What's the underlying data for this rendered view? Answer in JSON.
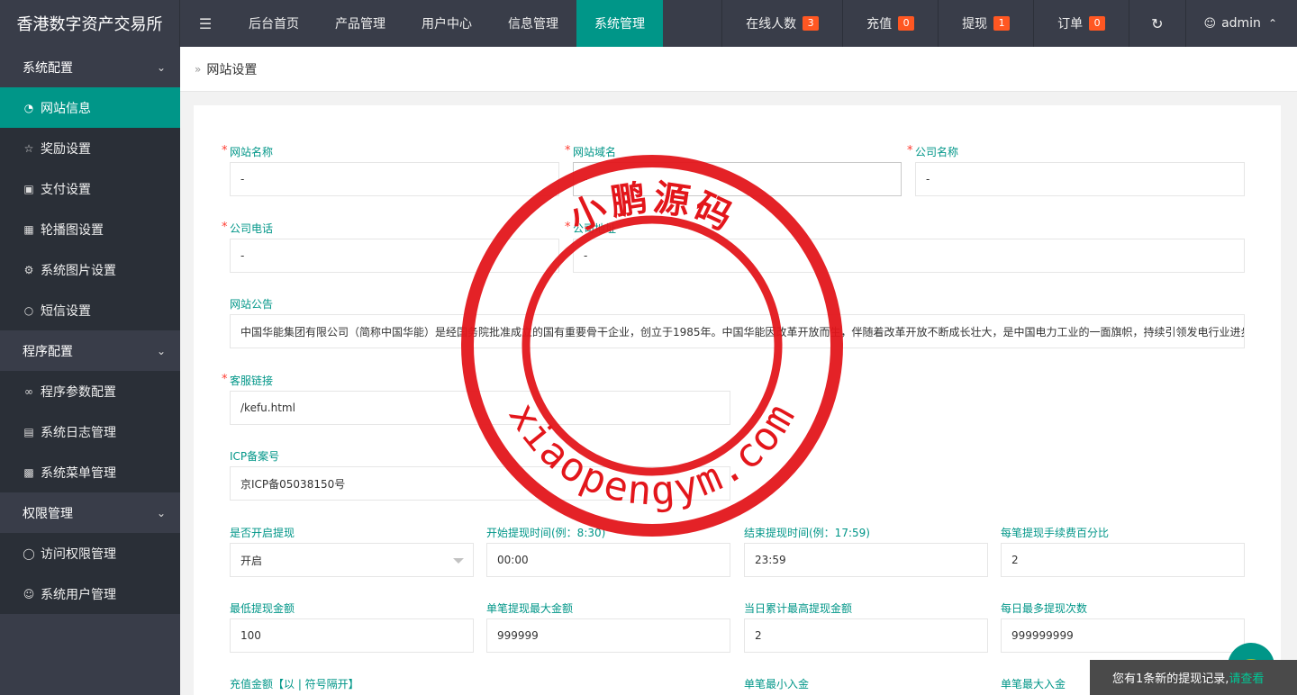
{
  "app": {
    "title": "香港数字资产交易所",
    "menu_icon": "menu-icon"
  },
  "nav": {
    "items": [
      {
        "label": "后台首页"
      },
      {
        "label": "产品管理"
      },
      {
        "label": "用户中心"
      },
      {
        "label": "信息管理"
      },
      {
        "label": "系统管理",
        "active": true
      }
    ],
    "right": [
      {
        "label": "在线人数",
        "badge": "3"
      },
      {
        "label": "充值",
        "badge": "0"
      },
      {
        "label": "提现",
        "badge": "1"
      },
      {
        "label": "订单",
        "badge": "0"
      }
    ],
    "refresh_icon": "refresh-icon",
    "user": "admin"
  },
  "sidebar": {
    "groups": [
      {
        "label": "系统配置",
        "items": [
          {
            "label": "网站信息",
            "icon": "dashboard-icon",
            "active": true
          },
          {
            "label": "奖励设置",
            "icon": "star-icon"
          },
          {
            "label": "支付设置",
            "icon": "money-icon"
          },
          {
            "label": "轮播图设置",
            "icon": "image-icon"
          },
          {
            "label": "系统图片设置",
            "icon": "gear-icon"
          },
          {
            "label": "短信设置",
            "icon": "chat-icon"
          }
        ]
      },
      {
        "label": "程序配置",
        "items": [
          {
            "label": "程序参数配置",
            "icon": "link-icon"
          },
          {
            "label": "系统日志管理",
            "icon": "log-icon"
          },
          {
            "label": "系统菜单管理",
            "icon": "table-icon"
          }
        ]
      },
      {
        "label": "权限管理",
        "items": [
          {
            "label": "访问权限管理",
            "icon": "shield-icon"
          },
          {
            "label": "系统用户管理",
            "icon": "user-icon"
          }
        ]
      }
    ]
  },
  "breadcrumb": {
    "label": "网站设置"
  },
  "form": {
    "site_name": {
      "label": "网站名称",
      "value": "-"
    },
    "site_domain": {
      "label": "网站域名",
      "value": "-"
    },
    "company_name": {
      "label": "公司名称",
      "value": "-"
    },
    "company_phone": {
      "label": "公司电话",
      "value": "-"
    },
    "company_address": {
      "label": "公司地址",
      "value": "-"
    },
    "notice": {
      "label": "网站公告",
      "value": "中国华能集团有限公司（简称中国华能）是经国务院批准成立的国有重要骨干企业，创立于1985年。中国华能因改革开放而生，伴随着改革开放不断成长壮大，是中国电力工业的一面旗帜，持续引领发电行业进步"
    },
    "kefu": {
      "label": "客服链接",
      "value": "/kefu.html"
    },
    "icp": {
      "label": "ICP备案号",
      "value": "京ICP备05038150号"
    },
    "withdraw_open": {
      "label": "是否开启提现",
      "value": "开启"
    },
    "withdraw_start": {
      "label": "开始提现时间(例：8:30)",
      "value": "00:00"
    },
    "withdraw_end": {
      "label": "结束提现时间(例：17:59)",
      "value": "23:59"
    },
    "withdraw_fee": {
      "label": "每笔提现手续费百分比",
      "value": "2"
    },
    "withdraw_min": {
      "label": "最低提现金额",
      "value": "100"
    },
    "withdraw_max_single": {
      "label": "单笔提现最大金额",
      "value": "999999"
    },
    "withdraw_max_daily": {
      "label": "当日累计最高提现金额",
      "value": "2"
    },
    "withdraw_times_daily": {
      "label": "每日最多提现次数",
      "value": "999999999"
    },
    "recharge_amounts": {
      "label": "充值金额【以 | 符号隔开】"
    },
    "deposit_min": {
      "label": "单笔最小入金"
    },
    "deposit_max": {
      "label": "单笔最大入金"
    }
  },
  "watermark": {
    "text_top": "小鹏源码",
    "text_bottom": "xiaopengym.com"
  },
  "toast": {
    "text": "您有1条新的提现记录,",
    "link": "请查看"
  }
}
